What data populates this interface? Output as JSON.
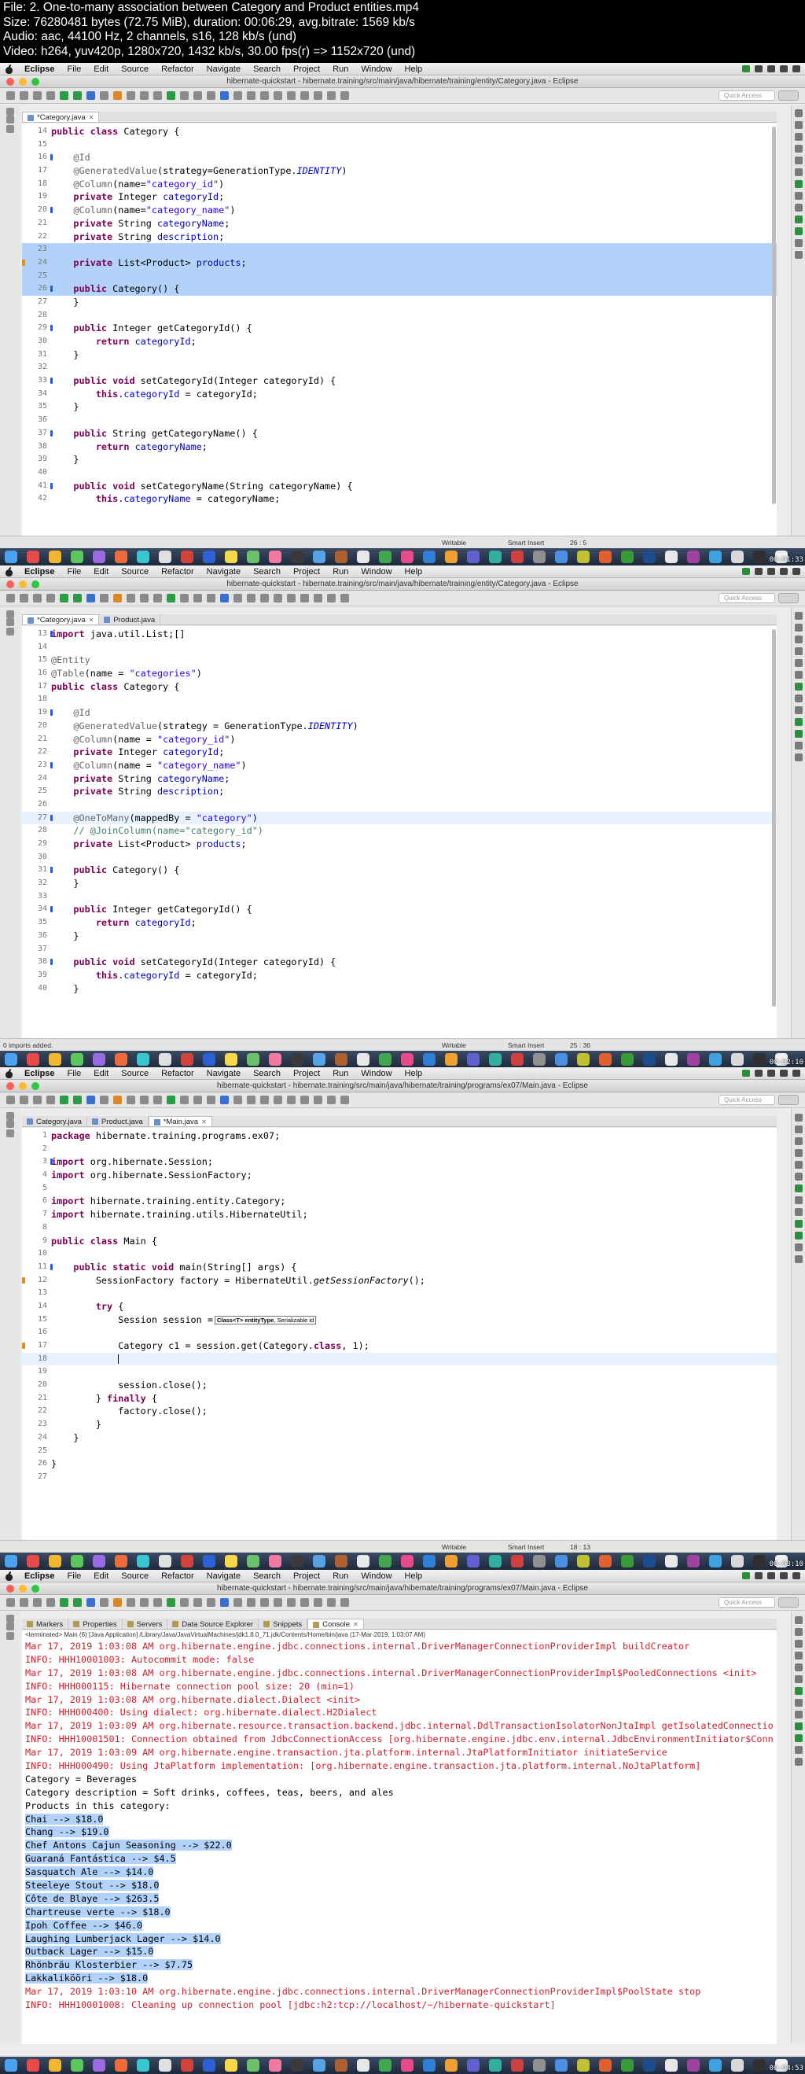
{
  "video_info": [
    "File: 2. One-to-many association between Category and Product entities.mp4",
    "Size: 76280481 bytes (72.75 MiB), duration: 00:06:29, avg.bitrate: 1569 kb/s",
    "Audio: aac, 44100 Hz, 2 channels, s16, 128 kb/s (und)",
    "Video: h264, yuv420p, 1280x720, 1432 kb/s, 30.00 fps(r) => 1152x720 (und)"
  ],
  "menu": [
    "Eclipse",
    "File",
    "Edit",
    "Source",
    "Refactor",
    "Navigate",
    "Search",
    "Project",
    "Run",
    "Window",
    "Help"
  ],
  "quick_access": "Quick Access",
  "frames": [
    {
      "window_title": "hibernate-quickstart - hibernate.training/src/main/java/hibernate/training/entity/Category.java - Eclipse",
      "tabs": [
        {
          "label": "*Category.java",
          "active": true
        }
      ],
      "lines": [
        {
          "n": "14",
          "html": "<span class=\"kw\">public class</span> Category {"
        },
        {
          "n": "15",
          "html": ""
        },
        {
          "n": "16",
          "html": "    <span class=\"ann\">@Id</span>",
          "mark": "fold"
        },
        {
          "n": "17",
          "html": "    <span class=\"ann\">@GeneratedValue</span>(strategy=GenerationType.<span class=\"ital\">IDENTITY</span>)"
        },
        {
          "n": "18",
          "html": "    <span class=\"ann\">@Column</span>(name=<span class=\"str\">\"category_id\"</span>)"
        },
        {
          "n": "19",
          "html": "    <span class=\"kw\">private</span> Integer <span class=\"fld\">categoryId</span>;"
        },
        {
          "n": "20",
          "html": "    <span class=\"ann\">@Column</span>(name=<span class=\"str\">\"category_name\"</span>)",
          "mark": "fold"
        },
        {
          "n": "21",
          "html": "    <span class=\"kw\">private</span> String <span class=\"fld\">categoryName</span>;"
        },
        {
          "n": "22",
          "html": "    <span class=\"kw\">private</span> String <span class=\"fld\">description</span>;"
        },
        {
          "n": "23",
          "html": "",
          "sel": true
        },
        {
          "n": "24",
          "html": "    <span class=\"kw\">private</span> List&lt;Product&gt; <span class=\"fld\">products</span>;",
          "sel": true,
          "mark": "warn"
        },
        {
          "n": "25",
          "html": "",
          "sel": true
        },
        {
          "n": "26",
          "html": "    <span class=\"kw\">public</span> Category() {",
          "sel": true,
          "mark": "fold"
        },
        {
          "n": "27",
          "html": "    }"
        },
        {
          "n": "28",
          "html": ""
        },
        {
          "n": "29",
          "html": "    <span class=\"kw\">public</span> Integer getCategoryId() {",
          "mark": "fold"
        },
        {
          "n": "30",
          "html": "        <span class=\"kw\">return</span> <span class=\"fld\">categoryId</span>;"
        },
        {
          "n": "31",
          "html": "    }"
        },
        {
          "n": "32",
          "html": ""
        },
        {
          "n": "33",
          "html": "    <span class=\"kw\">public void</span> setCategoryId(Integer categoryId) {",
          "mark": "fold"
        },
        {
          "n": "34",
          "html": "        <span class=\"kw\">this</span>.<span class=\"fld\">categoryId</span> = categoryId;"
        },
        {
          "n": "35",
          "html": "    }"
        },
        {
          "n": "36",
          "html": ""
        },
        {
          "n": "37",
          "html": "    <span class=\"kw\">public</span> String getCategoryName() {",
          "mark": "fold"
        },
        {
          "n": "38",
          "html": "        <span class=\"kw\">return</span> <span class=\"fld\">categoryName</span>;"
        },
        {
          "n": "39",
          "html": "    }"
        },
        {
          "n": "40",
          "html": ""
        },
        {
          "n": "41",
          "html": "    <span class=\"kw\">public void</span> setCategoryName(String categoryName) {",
          "mark": "fold"
        },
        {
          "n": "42",
          "html": "        <span class=\"kw\">this</span>.<span class=\"fld\">categoryName</span> = categoryName;"
        }
      ],
      "status": {
        "left": "",
        "writable": "Writable",
        "insert": "Smart Insert",
        "pos": "26 : 5"
      },
      "timestamp": "00:01:33"
    },
    {
      "window_title": "hibernate-quickstart - hibernate.training/src/main/java/hibernate/training/entity/Category.java - Eclipse",
      "tabs": [
        {
          "label": "*Category.java",
          "active": true
        },
        {
          "label": "Product.java",
          "active": false
        }
      ],
      "lines": [
        {
          "n": "13",
          "html": "<span class=\"kw\">import</span> java.util.List;[]",
          "mark": "fold"
        },
        {
          "n": "14",
          "html": ""
        },
        {
          "n": "15",
          "html": "<span class=\"ann\">@Entity</span>"
        },
        {
          "n": "16",
          "html": "<span class=\"ann\">@Table</span>(name = <span class=\"str\">\"categories\"</span>)"
        },
        {
          "n": "17",
          "html": "<span class=\"kw\">public class</span> Category {"
        },
        {
          "n": "18",
          "html": ""
        },
        {
          "n": "19",
          "html": "    <span class=\"ann\">@Id</span>",
          "mark": "fold"
        },
        {
          "n": "20",
          "html": "    <span class=\"ann\">@GeneratedValue</span>(strategy = GenerationType.<span class=\"ital\">IDENTITY</span>)"
        },
        {
          "n": "21",
          "html": "    <span class=\"ann\">@Column</span>(name = <span class=\"str\">\"category_id\"</span>)"
        },
        {
          "n": "22",
          "html": "    <span class=\"kw\">private</span> Integer <span class=\"fld\">categoryId</span>;"
        },
        {
          "n": "23",
          "html": "    <span class=\"ann\">@Column</span>(name = <span class=\"str\">\"category_name\"</span>)",
          "mark": "fold"
        },
        {
          "n": "24",
          "html": "    <span class=\"kw\">private</span> String <span class=\"fld\">categoryName</span>;"
        },
        {
          "n": "25",
          "html": "    <span class=\"kw\">private</span> String <span class=\"fld\">description</span>;"
        },
        {
          "n": "26",
          "html": ""
        },
        {
          "n": "27",
          "html": "    <span class=\"ann\">@OneToMany</span>(mappedBy = <span class=\"str\">\"category\"</span>)",
          "cur": true,
          "mark": "fold"
        },
        {
          "n": "28",
          "html": "    <span class=\"cmt\">// @JoinColumn(name=\"category_id\")</span>"
        },
        {
          "n": "29",
          "html": "    <span class=\"kw\">private</span> List&lt;Product&gt; <span class=\"fld\">products</span>;"
        },
        {
          "n": "30",
          "html": ""
        },
        {
          "n": "31",
          "html": "    <span class=\"kw\">public</span> Category() {",
          "mark": "fold"
        },
        {
          "n": "32",
          "html": "    }"
        },
        {
          "n": "33",
          "html": ""
        },
        {
          "n": "34",
          "html": "    <span class=\"kw\">public</span> Integer getCategoryId() {",
          "mark": "fold"
        },
        {
          "n": "35",
          "html": "        <span class=\"kw\">return</span> <span class=\"fld\">categoryId</span>;"
        },
        {
          "n": "36",
          "html": "    }"
        },
        {
          "n": "37",
          "html": ""
        },
        {
          "n": "38",
          "html": "    <span class=\"kw\">public void</span> setCategoryId(Integer categoryId) {",
          "mark": "fold"
        },
        {
          "n": "39",
          "html": "        <span class=\"kw\">this</span>.<span class=\"fld\">categoryId</span> = categoryId;"
        },
        {
          "n": "40",
          "html": "    }"
        }
      ],
      "status": {
        "left": "0 imports added.",
        "writable": "Writable",
        "insert": "Smart Insert",
        "pos": "25 : 36"
      },
      "timestamp": "00:02:10"
    },
    {
      "window_title": "hibernate-quickstart - hibernate.training/src/main/java/hibernate/training/programs/ex07/Main.java - Eclipse",
      "tabs": [
        {
          "label": "Category.java",
          "active": false
        },
        {
          "label": "Product.java",
          "active": false
        },
        {
          "label": "*Main.java",
          "active": true
        }
      ],
      "lines": [
        {
          "n": "1",
          "html": "<span class=\"kw\">package</span> hibernate.training.programs.ex07;"
        },
        {
          "n": "2",
          "html": ""
        },
        {
          "n": "3",
          "html": "<span class=\"kw\">import</span> org.hibernate.Session;",
          "mark": "fold"
        },
        {
          "n": "4",
          "html": "<span class=\"kw\">import</span> org.hibernate.SessionFactory;"
        },
        {
          "n": "5",
          "html": ""
        },
        {
          "n": "6",
          "html": "<span class=\"kw\">import</span> hibernate.training.entity.Category;"
        },
        {
          "n": "7",
          "html": "<span class=\"kw\">import</span> hibernate.training.utils.HibernateUtil;"
        },
        {
          "n": "8",
          "html": ""
        },
        {
          "n": "9",
          "html": "<span class=\"kw\">public class</span> Main {"
        },
        {
          "n": "10",
          "html": ""
        },
        {
          "n": "11",
          "html": "    <span class=\"kw\">public static void</span> main(String[] args) {",
          "mark": "fold"
        },
        {
          "n": "12",
          "html": "        SessionFactory factory = HibernateUtil.<span class=\"sm\">getSessionFactory</span>();",
          "mark": "warn"
        },
        {
          "n": "13",
          "html": ""
        },
        {
          "n": "14",
          "html": "        <span class=\"kw\">try</span> {"
        },
        {
          "n": "15",
          "html": "            Session session =<span class=\"hint\"><b>Class&lt;T&gt; entityType</b>, Serializable id</span>"
        },
        {
          "n": "16",
          "html": ""
        },
        {
          "n": "17",
          "html": "            Category c1 = session.get(Category.<span class=\"kw\">class</span>, 1);",
          "mark": "warn"
        },
        {
          "n": "18",
          "html": "            <span class=\"caret\"></span>",
          "cur": true
        },
        {
          "n": "19",
          "html": ""
        },
        {
          "n": "20",
          "html": "            session.close();"
        },
        {
          "n": "21",
          "html": "        } <span class=\"kw\">finally</span> {"
        },
        {
          "n": "22",
          "html": "            factory.close();"
        },
        {
          "n": "23",
          "html": "        }"
        },
        {
          "n": "24",
          "html": "    }"
        },
        {
          "n": "25",
          "html": ""
        },
        {
          "n": "26",
          "html": "}"
        },
        {
          "n": "27",
          "html": ""
        }
      ],
      "status": {
        "left": "",
        "writable": "Writable",
        "insert": "Smart Insert",
        "pos": "18 : 13"
      },
      "timestamp": "00:03:10"
    }
  ],
  "console_frame": {
    "window_title": "hibernate-quickstart - hibernate.training/src/main/java/hibernate/training/programs/ex07/Main.java - Eclipse",
    "view_tabs": [
      "Markers",
      "Properties",
      "Servers",
      "Data Source Explorer",
      "Snippets",
      "Console"
    ],
    "terminated": "<terminated> Main (6) [Java Application] /Library/Java/JavaVirtualMachines/jdk1.8.0_71.jdk/Contents/Home/bin/java (17-Mar-2019, 1:03:07 AM)",
    "lines": [
      {
        "c": "red",
        "t": "Mar 17, 2019 1:03:08 AM org.hibernate.engine.jdbc.connections.internal.DriverManagerConnectionProviderImpl buildCreator"
      },
      {
        "c": "red",
        "t": "INFO: HHH10001003: Autocommit mode: false"
      },
      {
        "c": "red",
        "t": "Mar 17, 2019 1:03:08 AM org.hibernate.engine.jdbc.connections.internal.DriverManagerConnectionProviderImpl$PooledConnections <init>"
      },
      {
        "c": "red",
        "t": "INFO: HHH000115: Hibernate connection pool size: 20 (min=1)"
      },
      {
        "c": "red",
        "t": "Mar 17, 2019 1:03:08 AM org.hibernate.dialect.Dialect <init>"
      },
      {
        "c": "red",
        "t": "INFO: HHH000400: Using dialect: org.hibernate.dialect.H2Dialect"
      },
      {
        "c": "red",
        "t": "Mar 17, 2019 1:03:09 AM org.hibernate.resource.transaction.backend.jdbc.internal.DdlTransactionIsolatorNonJtaImpl getIsolatedConnectio"
      },
      {
        "c": "red",
        "t": "INFO: HHH10001501: Connection obtained from JdbcConnectionAccess [org.hibernate.engine.jdbc.env.internal.JdbcEnvironmentInitiator$Conn"
      },
      {
        "c": "red",
        "t": "Mar 17, 2019 1:03:09 AM org.hibernate.engine.transaction.jta.platform.internal.JtaPlatformInitiator initiateService"
      },
      {
        "c": "red",
        "t": "INFO: HHH000490: Using JtaPlatform implementation: [org.hibernate.engine.transaction.jta.platform.internal.NoJtaPlatform]"
      },
      {
        "c": "blk",
        "t": "Category = Beverages"
      },
      {
        "c": "blk",
        "t": "Category description = Soft drinks, coffees, teas, beers, and ales"
      },
      {
        "c": "blk",
        "t": "Products in this category:"
      },
      {
        "c": "blk",
        "t": "Chai --> $18.0",
        "hl": true
      },
      {
        "c": "blk",
        "t": "Chang --> $19.0",
        "hl": true
      },
      {
        "c": "blk",
        "t": "Chef Antons Cajun Seasoning --> $22.0",
        "hl": true
      },
      {
        "c": "blk",
        "t": "Guaraná Fantástica --> $4.5",
        "hl": true
      },
      {
        "c": "blk",
        "t": "Sasquatch Ale --> $14.0",
        "hl": true
      },
      {
        "c": "blk",
        "t": "Steeleye Stout --> $18.0",
        "hl": true
      },
      {
        "c": "blk",
        "t": "Côte de Blaye --> $263.5",
        "hl": true
      },
      {
        "c": "blk",
        "t": "Chartreuse verte --> $18.0",
        "hl": true
      },
      {
        "c": "blk",
        "t": "Ipoh Coffee --> $46.0",
        "hl": true
      },
      {
        "c": "blk",
        "t": "Laughing Lumberjack Lager --> $14.0",
        "hl": true
      },
      {
        "c": "blk",
        "t": "Outback Lager --> $15.0",
        "hl": true
      },
      {
        "c": "blk",
        "t": "Rhönbräu Klosterbier --> $7.75",
        "hl": true
      },
      {
        "c": "blk",
        "t": "Lakkalikööri --> $18.0",
        "hl": true
      },
      {
        "c": "red",
        "t": "Mar 17, 2019 1:03:10 AM org.hibernate.engine.jdbc.connections.internal.DriverManagerConnectionProviderImpl$PoolState stop"
      },
      {
        "c": "red",
        "t": "INFO: HHH10001008: Cleaning up connection pool [jdbc:h2:tcp://localhost/~/hibernate-quickstart]"
      }
    ],
    "timestamp": "00:04:53"
  },
  "colors": {
    "keyword": "#7f0055",
    "string": "#2a00ff",
    "field": "#0000c0",
    "annotation": "#646464",
    "comment": "#3f7f5f",
    "selection": "#b3d2f9",
    "console_error": "#d1202d"
  }
}
